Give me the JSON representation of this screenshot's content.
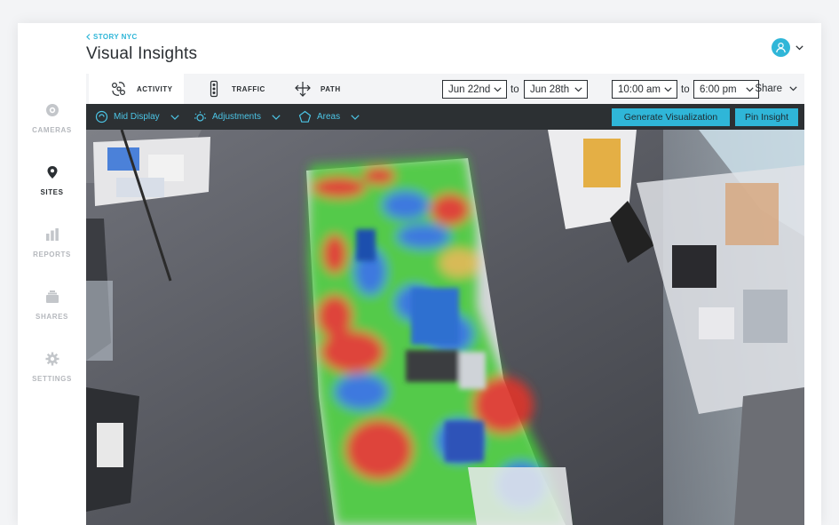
{
  "header": {
    "breadcrumb": "STORY NYC",
    "title": "Visual Insights"
  },
  "sidebar": {
    "items": [
      {
        "label": "CAMERAS",
        "icon": "camera-icon",
        "active": false
      },
      {
        "label": "SITES",
        "icon": "location-pin-icon",
        "active": true
      },
      {
        "label": "REPORTS",
        "icon": "bar-chart-icon",
        "active": false
      },
      {
        "label": "SHARES",
        "icon": "stack-icon",
        "active": false
      },
      {
        "label": "SETTINGS",
        "icon": "gear-icon",
        "active": false
      }
    ]
  },
  "tabs": [
    {
      "label": "ACTIVITY",
      "icon": "activity-icon",
      "active": true
    },
    {
      "label": "TRAFFIC",
      "icon": "traffic-light-icon",
      "active": false
    },
    {
      "label": "PATH",
      "icon": "path-arrows-icon",
      "active": false
    }
  ],
  "filters": {
    "start_date": "Jun 22nd",
    "end_date": "Jun 28th",
    "start_time": "10:00 am",
    "end_time": "6:00 pm",
    "to_label": "to",
    "share_label": "Share"
  },
  "toolbar": {
    "display_label": "Mid Display",
    "adjustments_label": "Adjustments",
    "areas_label": "Areas",
    "generate_label": "Generate Visualization",
    "pin_label": "Pin Insight"
  },
  "colors": {
    "accent": "#2fb6d8",
    "toolbar_bg": "#2c3033",
    "heat_high": "#e0342b",
    "heat_mid": "#46c93b",
    "heat_low": "#2f6fe0"
  }
}
